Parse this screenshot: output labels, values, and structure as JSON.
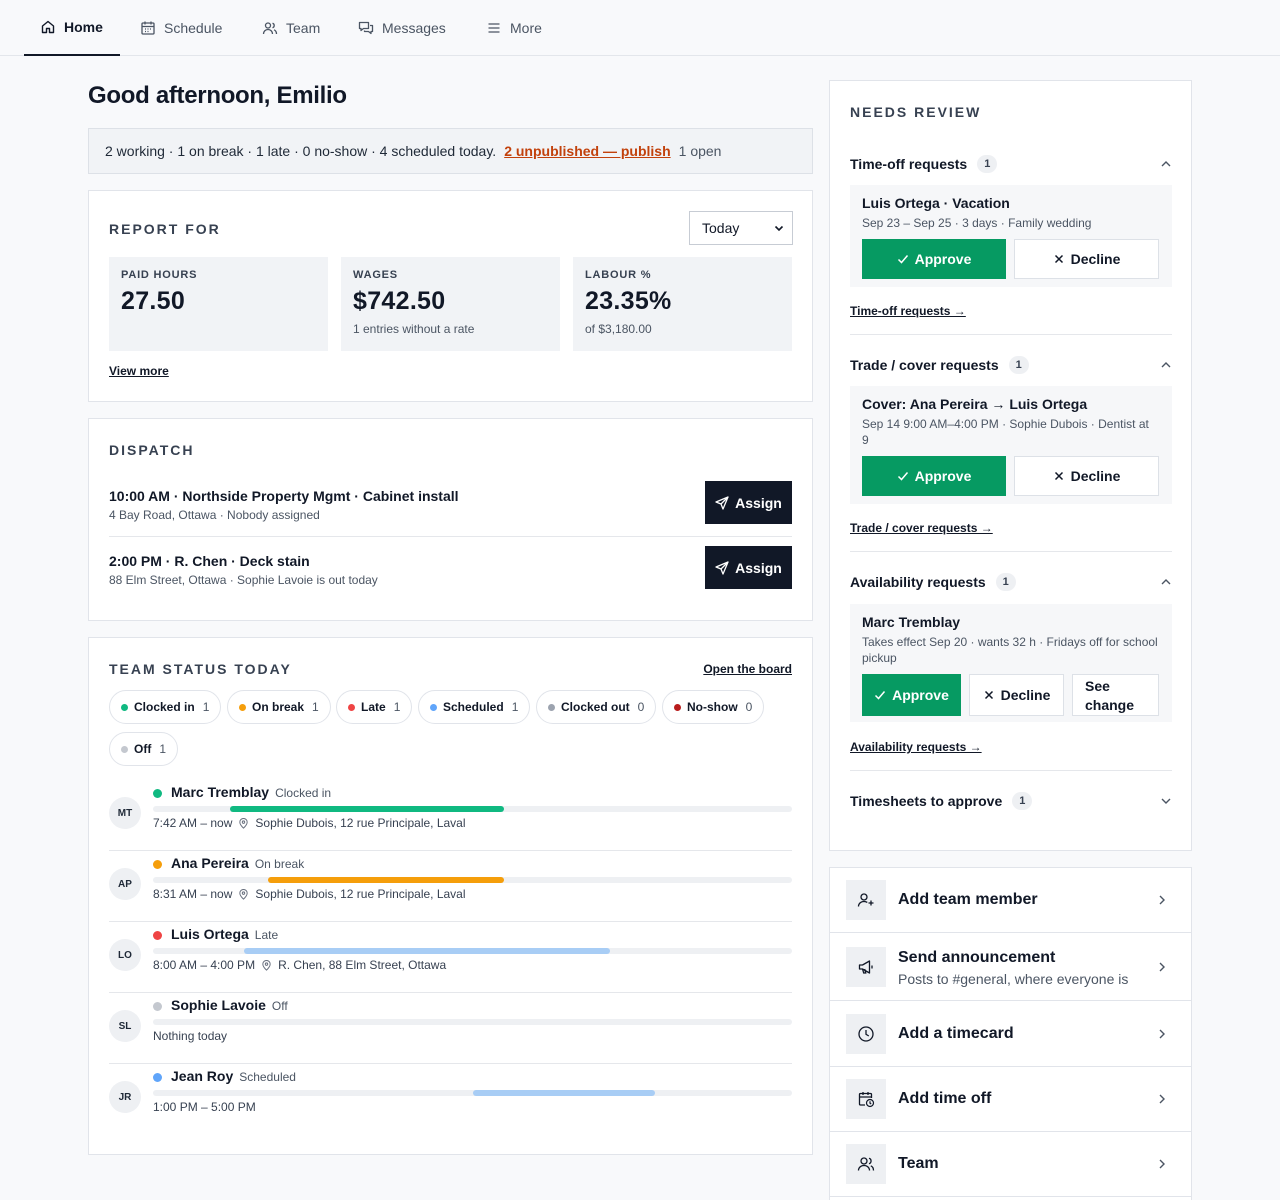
{
  "nav": {
    "tabs": [
      {
        "label": "Home",
        "icon": "home-icon",
        "active": true
      },
      {
        "label": "Schedule",
        "icon": "calendar-icon"
      },
      {
        "label": "Team",
        "icon": "users-icon"
      },
      {
        "label": "Messages",
        "icon": "chat-icon"
      },
      {
        "label": "More",
        "icon": "menu-icon"
      }
    ]
  },
  "greeting": "Good afternoon, Emilio",
  "summary": {
    "text": "2 working · 1 on break · 1 late · 0 no-show · 4 scheduled today.",
    "unpublished_link": "2 unpublished — publish",
    "open": "1 open"
  },
  "report": {
    "title": "REPORT FOR",
    "period": "Today",
    "stats": [
      {
        "label": "PAID HOURS",
        "value": "27.50",
        "sub": ""
      },
      {
        "label": "WAGES",
        "value": "$742.50",
        "sub": "1 entries without a rate"
      },
      {
        "label": "LABOUR %",
        "value": "23.35%",
        "sub": "of $3,180.00"
      }
    ],
    "view_more": "View more"
  },
  "dispatch": {
    "title": "DISPATCH",
    "assign_label": "Assign",
    "jobs": [
      {
        "title": "10:00 AM · Northside Property Mgmt · Cabinet install",
        "sub": "4 Bay Road, Ottawa · Nobody assigned"
      },
      {
        "title": "2:00 PM · R. Chen · Deck stain",
        "sub": "88 Elm Street, Ottawa · Sophie Lavoie is out today"
      }
    ]
  },
  "team_status": {
    "title": "TEAM STATUS TODAY",
    "open_board": "Open the board",
    "chips": [
      {
        "label": "Clocked in",
        "count": "1",
        "color": "#10b981"
      },
      {
        "label": "On break",
        "count": "1",
        "color": "#f59e0b"
      },
      {
        "label": "Late",
        "count": "1",
        "color": "#ef4444"
      },
      {
        "label": "Scheduled",
        "count": "1",
        "color": "#60a5fa"
      },
      {
        "label": "Clocked out",
        "count": "0",
        "color": "#9ca3af"
      },
      {
        "label": "No-show",
        "count": "0",
        "color": "#b91c1c"
      },
      {
        "label": "Off",
        "count": "1",
        "color": "#c4c8cf"
      }
    ],
    "members": [
      {
        "initials": "MT",
        "name": "Marc Tremblay",
        "status": "Clocked in",
        "dot": "#10b981",
        "bar": "#10b981",
        "bar_start": 0.12,
        "bar_end": 0.55,
        "time": "7:42 AM – now",
        "location": "Sophie Dubois, 12 rue Principale, Laval"
      },
      {
        "initials": "AP",
        "name": "Ana Pereira",
        "status": "On break",
        "dot": "#f59e0b",
        "bar": "#f59e0b",
        "bar_start": 0.18,
        "bar_end": 0.55,
        "time": "8:31 AM – now",
        "location": "Sophie Dubois, 12 rue Principale, Laval"
      },
      {
        "initials": "LO",
        "name": "Luis Ortega",
        "status": "Late",
        "dot": "#ef4444",
        "bar": "#a8cdf5",
        "bar_start": 0.143,
        "bar_end": 0.715,
        "time": "8:00 AM – 4:00 PM",
        "location": "R. Chen, 88 Elm Street, Ottawa"
      },
      {
        "initials": "SL",
        "name": "Sophie Lavoie",
        "status": "Off",
        "dot": "#c4c8cf",
        "bar": "",
        "bar_start": 0,
        "bar_end": 0,
        "time": "Nothing today",
        "location": ""
      },
      {
        "initials": "JR",
        "name": "Jean Roy",
        "status": "Scheduled",
        "dot": "#60a5fa",
        "bar": "#a8cdf5",
        "bar_start": 0.5,
        "bar_end": 0.785,
        "time": "1:00 PM – 5:00 PM",
        "location": ""
      }
    ]
  },
  "review": {
    "title": "NEEDS REVIEW",
    "approve": "Approve",
    "decline": "Decline",
    "see_change": "See change",
    "groups": [
      {
        "label": "Time-off requests",
        "count": "1",
        "req_title": "Luis Ortega · Vacation",
        "req_sub": "Sep 23 – Sep 25 · 3 days · Family wedding",
        "link": "Time-off requests →"
      },
      {
        "label": "Trade / cover requests",
        "count": "1",
        "req_title": "Cover: Ana Pereira → Luis Ortega",
        "req_sub": "Sep 14 9:00 AM–4:00 PM · Sophie Dubois · Dentist at 9",
        "link": "Trade / cover requests →"
      },
      {
        "label": "Availability requests",
        "count": "1",
        "req_title": "Marc Tremblay",
        "req_sub": "Takes effect Sep 20 · wants 32 h · Fridays off for school pickup",
        "link": "Availability requests →"
      },
      {
        "label": "Timesheets to approve",
        "count": "1"
      }
    ]
  },
  "actions": [
    {
      "label": "Add team member",
      "sub": "",
      "icon": "add-user-icon"
    },
    {
      "label": "Send announcement",
      "sub": "Posts to #general, where everyone is",
      "icon": "megaphone-icon"
    },
    {
      "label": "Add a timecard",
      "sub": "",
      "icon": "clock-icon"
    },
    {
      "label": "Add time off",
      "sub": "",
      "icon": "calendar-clock-icon"
    },
    {
      "label": "Team",
      "sub": "",
      "icon": "users-icon"
    }
  ]
}
